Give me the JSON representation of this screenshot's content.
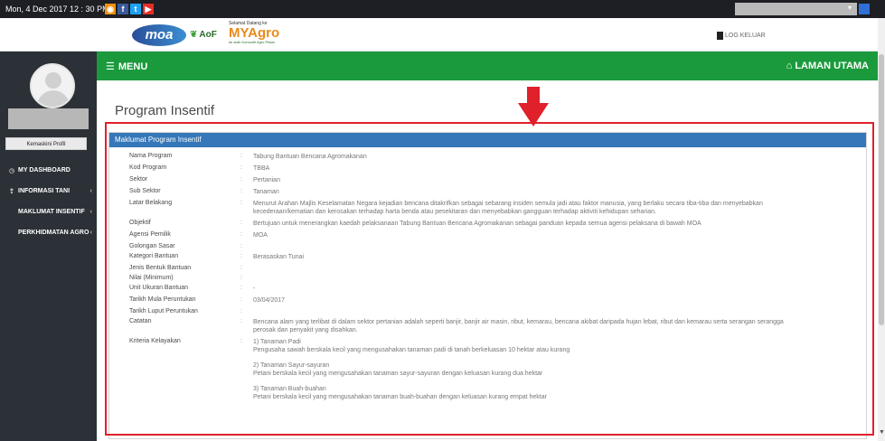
{
  "topbar": {
    "datetime": "Mon, 4 Dec 2017 12 : 30 PM",
    "social": [
      "rss-icon",
      "facebook-icon",
      "twitter-icon",
      "youtube-icon"
    ],
    "colors": {
      "rss": "#f0900d",
      "facebook": "#3b5998",
      "twitter": "#1da1f2",
      "youtube": "#e52d27"
    }
  },
  "logos": {
    "moa": "moa",
    "aof": "AoF",
    "myagro_tagline": "Selamat Datang ke",
    "myagro": "MYAgro",
    "myagro_sub": "ke arah Komuniti Agro Pintar"
  },
  "header": {
    "logout": "LOG KELUAR",
    "menu": "MENU",
    "home": "LAMAN UTAMA",
    "accent": "#1a9a3c"
  },
  "sidebar": {
    "profile_button": "Kemaskini Profil",
    "items": [
      {
        "label": "MY DASHBOARD",
        "icon": "dashboard-icon",
        "chevron": ""
      },
      {
        "label": "INFORMASI TANI",
        "icon": "info-icon",
        "chevron": "‹"
      },
      {
        "label": "MAKLUMAT INSENTIF",
        "icon": "",
        "chevron": "‹"
      },
      {
        "label": "PERKHIDMATAN AGRO",
        "icon": "",
        "chevron": "‹"
      }
    ]
  },
  "page": {
    "title": "Program Insentif",
    "panel_title": "Maklumat Program Insentif",
    "highlight_color": "#e0202a"
  },
  "fields": [
    {
      "label": "Nama Program",
      "value": "Tabung Bantuan Bencana Agromakanan"
    },
    {
      "label": "Kod Program",
      "value": "TBBA"
    },
    {
      "label": "Sektor",
      "value": "Pertanian"
    },
    {
      "label": "Sub Sektor",
      "value": "Tanaman"
    },
    {
      "label": "Latar Belakang",
      "value": "Menurut Arahan Majlis Keselamatan Negara kejadian bencana ditakrifkan sebagai sebarang insiden semula jadi atau faktor manusia, yang berlaku secara tiba-tiba dan menyebabkan kecederaan/kematian dan kerosakan terhadap harta benda atau pesekitaran dan menyebabkan gangguan terhadap aktiviti kehidupan seharian."
    },
    {
      "label": "Objektif",
      "value": "Bertujuan untuk menerangkan kaedah pelaksanaan Tabung Bantuan Bencana Agromakanan sebagai panduan kepada semua agensi pelaksana di bawah MOA"
    },
    {
      "label": "Agensi Pemilik",
      "value": "MOA"
    },
    {
      "label": "Golongan Sasar",
      "value": ""
    },
    {
      "label": "Kategori Bantuan",
      "value": "Berasaskan Tunai"
    },
    {
      "label": "Jenis Bentuk Bantuan",
      "value": ""
    },
    {
      "label": "Nilai (Minimum)",
      "value": ""
    },
    {
      "label": "Unit Ukuran Bantuan",
      "value": "-"
    },
    {
      "label": "Tarikh Mula Peruntukan",
      "value": "03/04/2017"
    },
    {
      "label": "Tarikh Luput Peruntukan",
      "value": ""
    },
    {
      "label": "Catatan",
      "value": "Bencana alam yang terlibat di dalam sektor pertanian adalah seperti banjir, banjir air masin, ribut, kemarau, bencana akibat daripada hujan lebat, ribut dan kemarau serta serangan serangga perosak dan penyakit yang disahkan."
    }
  ],
  "kriteria": {
    "label": "Kriteria Kelayakan",
    "lines": [
      "1) Tanaman Padi",
      "Pengusaha sawah berskala kecil yang mengusahakan tanaman padi di tanah berkeluasan 10 hektar atau kurang",
      "",
      "2) Tanaman Sayur-sayuran",
      "Petani berskala kecil yang mengusahakan tanaman sayur-sayuran dengan keluasan kurang dua hektar",
      "",
      "3) Tanaman Buah-buahan",
      "Petani berskala kecil yang mengusahakan tanaman buah-buahan dengan keluasan kurang empat hektar"
    ]
  }
}
